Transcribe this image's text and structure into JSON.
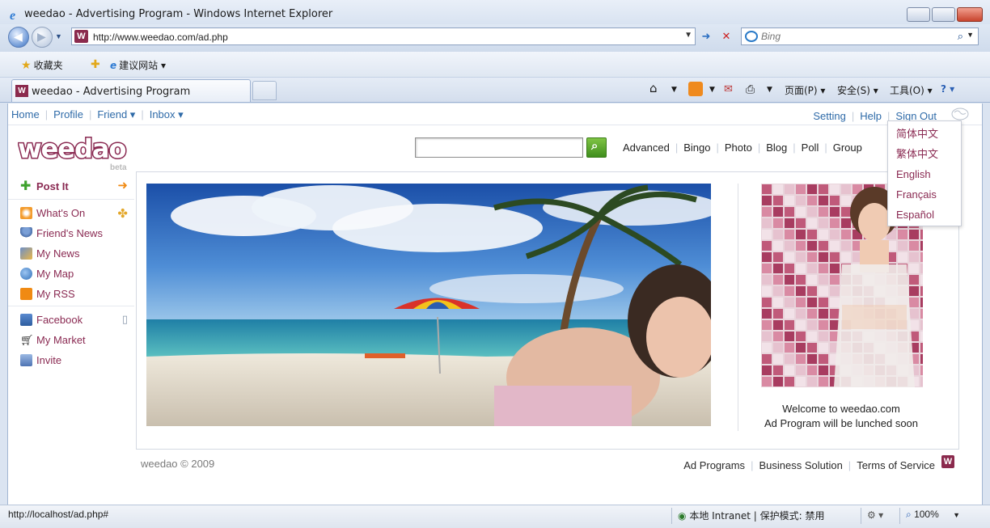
{
  "window": {
    "title": "weedao - Advertising Program - Windows Internet Explorer",
    "address_url": "http://www.weedao.com/ad.php",
    "search_placeholder": "Bing",
    "favorites_label": "收藏夹",
    "suggested_sites_label": "建议网站",
    "tab_label": "weedao - Advertising Program",
    "cmd_page": "页面(P)",
    "cmd_safety": "安全(S)",
    "cmd_tools": "工具(O)"
  },
  "site": {
    "topnav": [
      "Home",
      "Profile",
      "Friend ▾",
      "Inbox ▾"
    ],
    "topright": [
      "Setting",
      "Help",
      "Sign Out"
    ],
    "logo_text": "weedao",
    "logo_badge": "beta",
    "search_value": "",
    "catnav": [
      "Advanced",
      "Bingo",
      "Photo",
      "Blog",
      "Poll",
      "Group"
    ],
    "sidebar": {
      "post": "Post It",
      "group1": [
        "What's On",
        "Friend's News",
        "My News",
        "My Map",
        "My RSS"
      ],
      "group2": [
        "Facebook",
        "My Market",
        "Invite"
      ]
    },
    "welcome_line1": "Welcome to weedao.com",
    "welcome_line2": "Ad Program will be lunched soon",
    "copyright": "weedao © 2009",
    "footer_links": [
      "Ad Programs",
      "Business Solution",
      "Terms of Service"
    ],
    "languages": [
      "简体中文",
      "繁体中文",
      "English",
      "Français",
      "Español"
    ]
  },
  "statusbar": {
    "text": "http://localhost/ad.php#",
    "zone": "本地 Intranet | 保护模式: 禁用",
    "zoom": "100%"
  },
  "colors": {
    "brand": "#8a2a52",
    "link": "#2e6aa8",
    "search_button": "#4f9e2a"
  }
}
